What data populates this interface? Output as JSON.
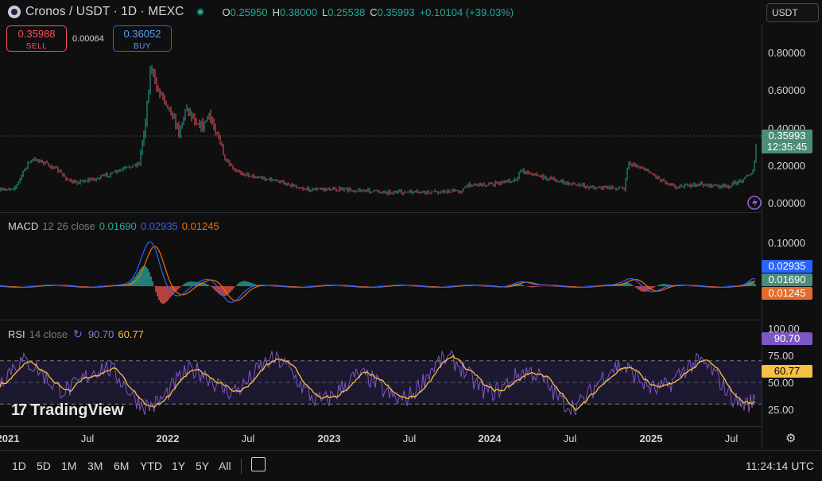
{
  "header": {
    "symbol_title": "Cronos / USDT · 1D · MEXC",
    "ohlc": [
      {
        "key": "O",
        "value": "0.25950"
      },
      {
        "key": "H",
        "value": "0.38000"
      },
      {
        "key": "L",
        "value": "0.25538"
      },
      {
        "key": "C",
        "value": "0.35993"
      }
    ],
    "change": "+0.10104 (+39.03%)",
    "currency": "USDT",
    "icons": {
      "symbol": "cronos-logo-icon",
      "status": "market-open-dot-icon",
      "currency": "chevron-down-icon"
    }
  },
  "trade": {
    "sell_price": "0.35988",
    "sell_label": "SELL",
    "spread": "0.00064",
    "buy_price": "0.36052",
    "buy_label": "BUY"
  },
  "price_axis": {
    "ticks": [
      "0.80000",
      "0.60000",
      "0.40000",
      "0.20000",
      "0.00000"
    ],
    "last_price": "0.35993",
    "countdown": "12:35:45"
  },
  "macd": {
    "name": "MACD",
    "params": "12 26 close",
    "values": [
      "0.01690",
      "0.02935",
      "0.01245"
    ],
    "ticks": [
      "0.10000"
    ],
    "tags": [
      "0.02935",
      "0.01690",
      "0.01245"
    ],
    "colors": {
      "macd": "#2962ff",
      "signal": "#ff6d00",
      "hist_up": "#26a69a",
      "hist_down": "#ef5350"
    }
  },
  "rsi": {
    "name": "RSI",
    "params": "14 close",
    "values": [
      "90.70",
      "60.77"
    ],
    "ticks": [
      "100.00",
      "75.00",
      "50.00",
      "25.00"
    ],
    "tags": [
      "90.70",
      "60.77"
    ],
    "colors": {
      "rsi": "#7e57c2",
      "ma": "#f5c142"
    }
  },
  "time_axis": {
    "labels": [
      "2021",
      "Jul",
      "2022",
      "Jul",
      "2023",
      "Jul",
      "2024",
      "Jul",
      "2025",
      "Jul"
    ]
  },
  "bottom": {
    "ranges": [
      "1D",
      "5D",
      "1M",
      "3M",
      "6M",
      "YTD",
      "1Y",
      "5Y",
      "All"
    ],
    "clock": "11:24:14 UTC",
    "icons": {
      "goto": "calendar-range-icon",
      "settings": "gear-icon"
    }
  },
  "watermark": "TradingView",
  "colors": {
    "up": "#22ab94",
    "down": "#f7525f",
    "buy": "#2962ff",
    "bg": "#0f0f0f"
  }
}
